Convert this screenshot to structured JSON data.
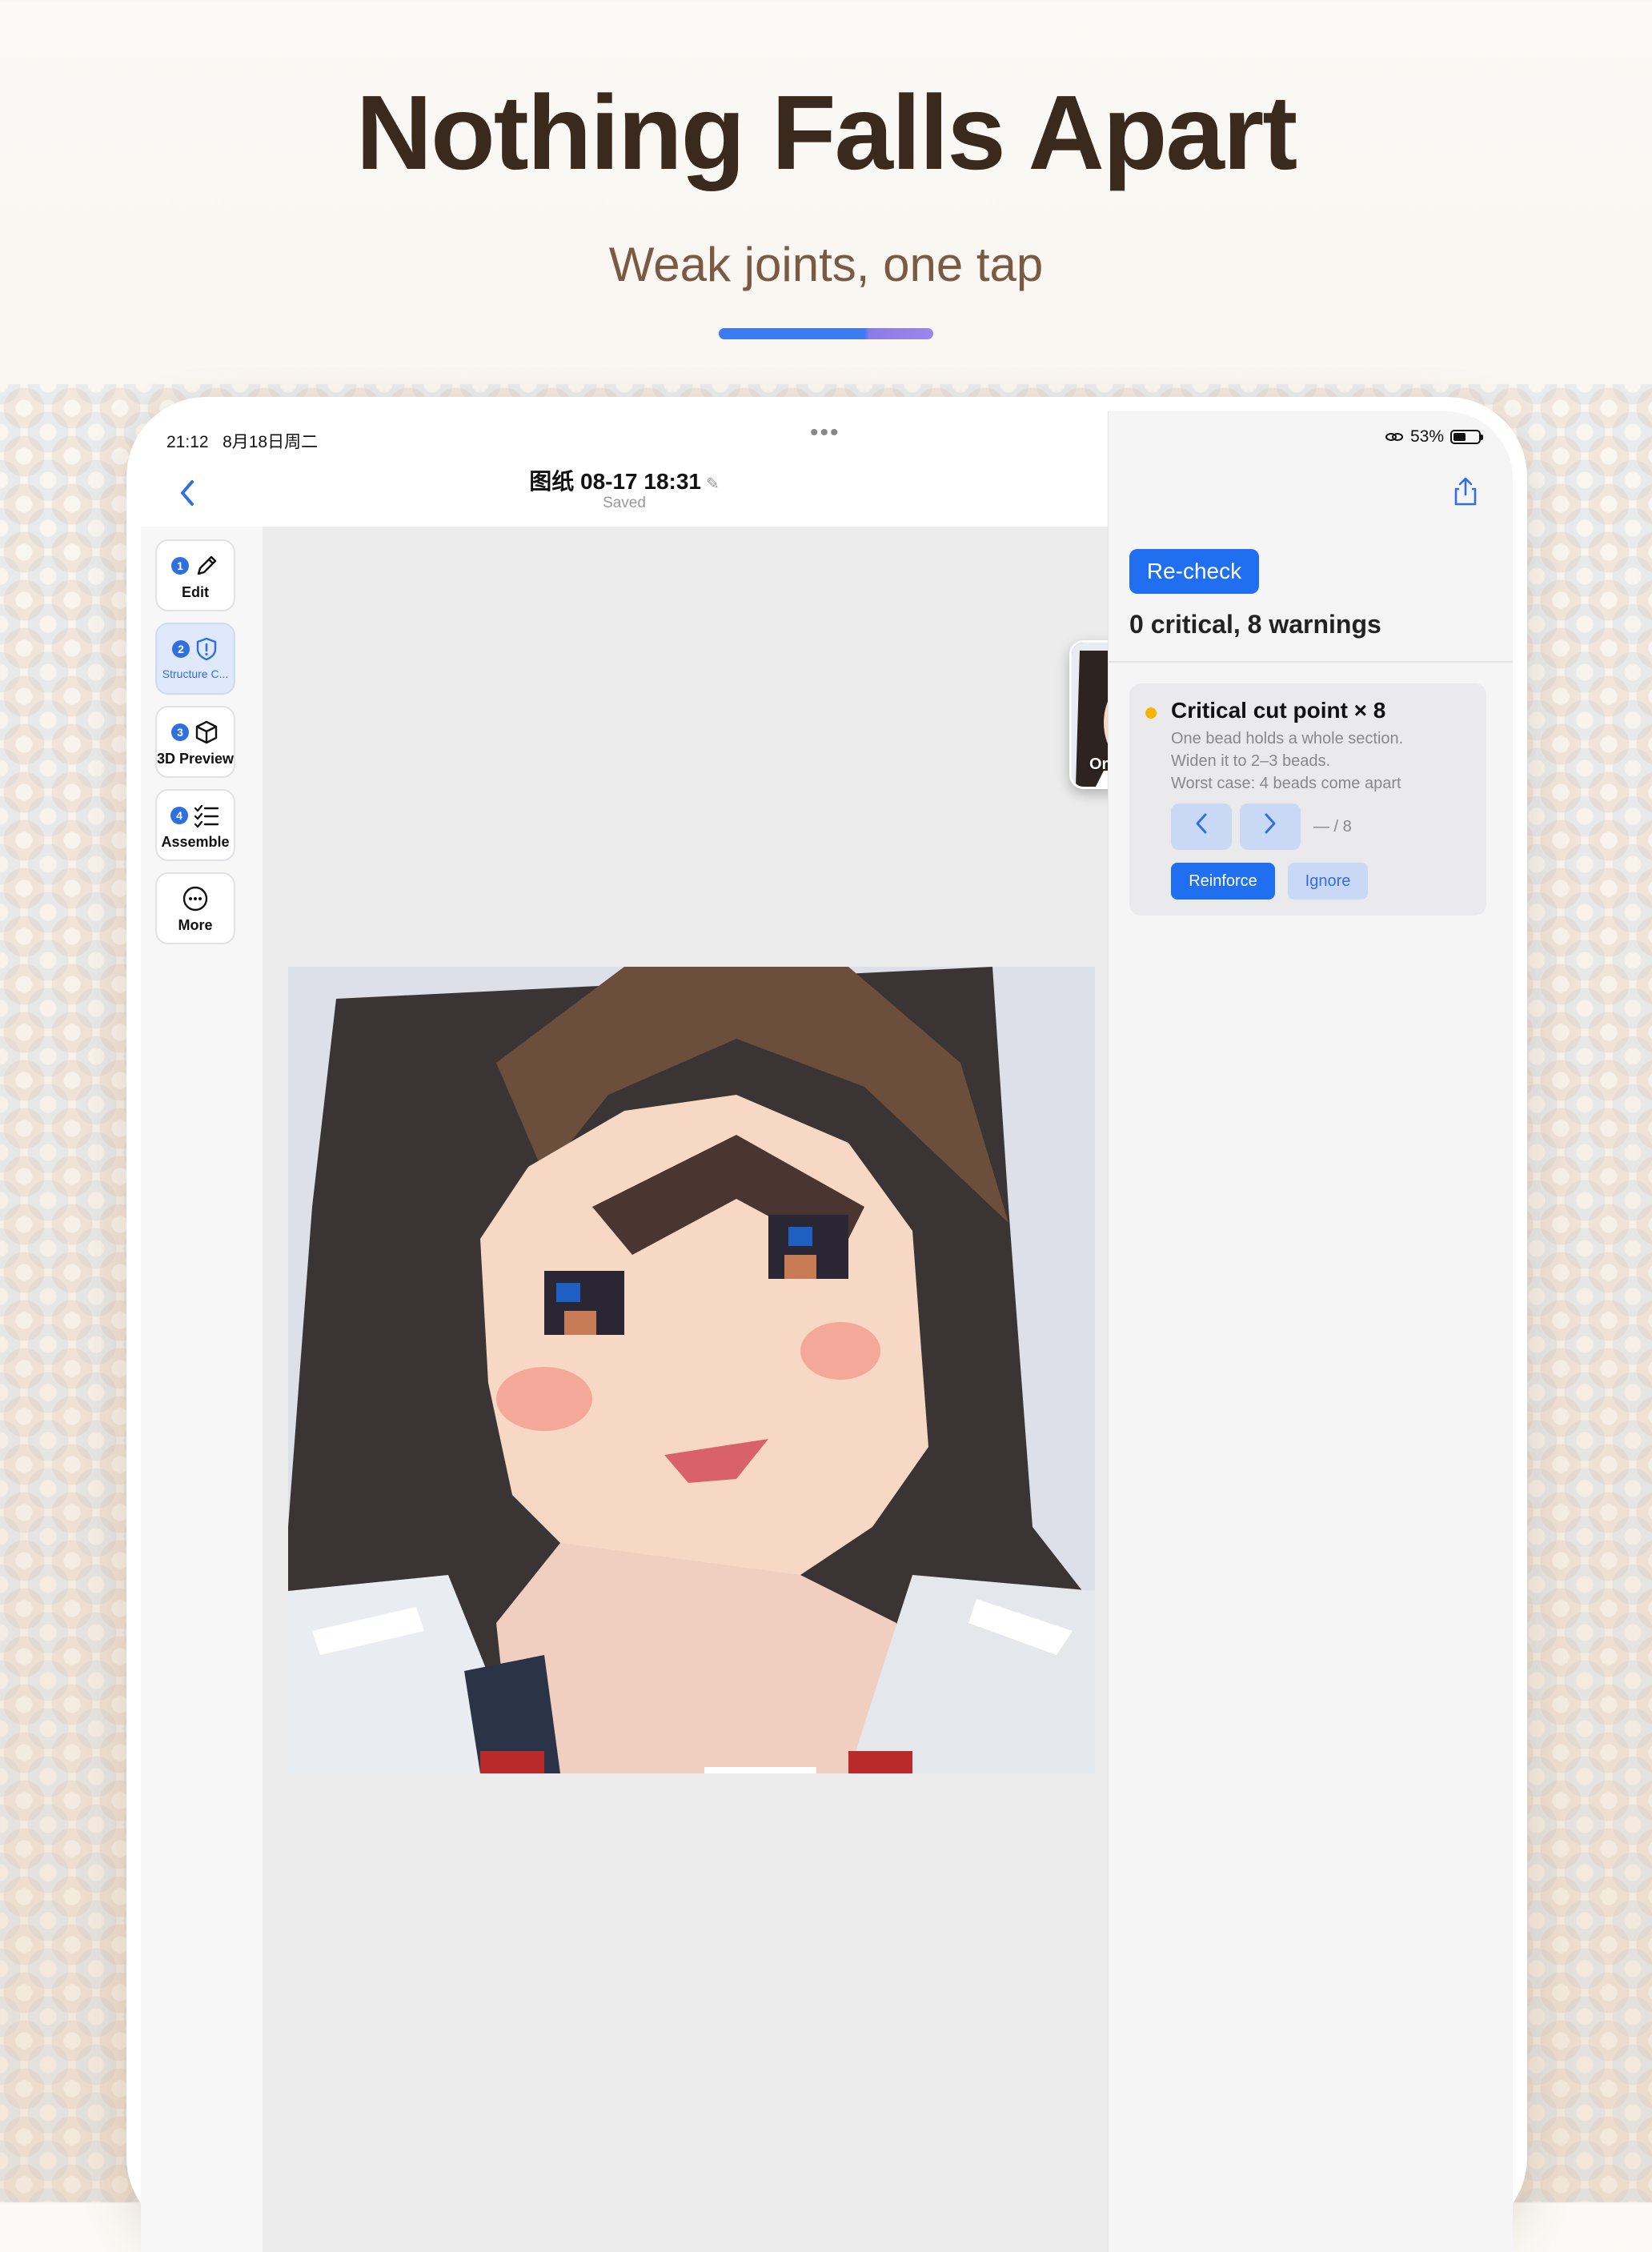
{
  "promo": {
    "headline": "Nothing Falls Apart",
    "subline": "Weak joints, one tap",
    "accent_colors": [
      "#3d7bf0",
      "#9b86e8"
    ]
  },
  "status_bar": {
    "time": "21:12",
    "date": "8月18日周二",
    "battery": "53%"
  },
  "header": {
    "title": "图纸 08-17 18:31",
    "subtitle": "Saved"
  },
  "toolbar": {
    "items": [
      {
        "num": "1",
        "label": "Edit",
        "icon": "pencil-icon"
      },
      {
        "num": "2",
        "label": "Structure C...",
        "icon": "shield-alert-icon"
      },
      {
        "num": "3",
        "label": "3D Preview",
        "icon": "cube-icon"
      },
      {
        "num": "4",
        "label": "Assemble",
        "icon": "checklist-icon"
      },
      {
        "label": "More",
        "icon": "ellipsis-circle-icon"
      }
    ]
  },
  "canvas": {
    "original_label": "Original",
    "close_glyph": "×"
  },
  "panel": {
    "recheck_label": "Re-check",
    "summary": "0 critical, 8 warnings",
    "issue": {
      "title": "Critical cut point × 8",
      "lines": [
        "One bead holds a whole section.",
        "Widen it to 2–3 beads.",
        "Worst case: 4 beads come apart"
      ],
      "counter": "— / 8",
      "reinforce_label": "Reinforce",
      "ignore_label": "Ignore",
      "severity_color": "#f4b400"
    },
    "accent": "#1f6ff0"
  }
}
